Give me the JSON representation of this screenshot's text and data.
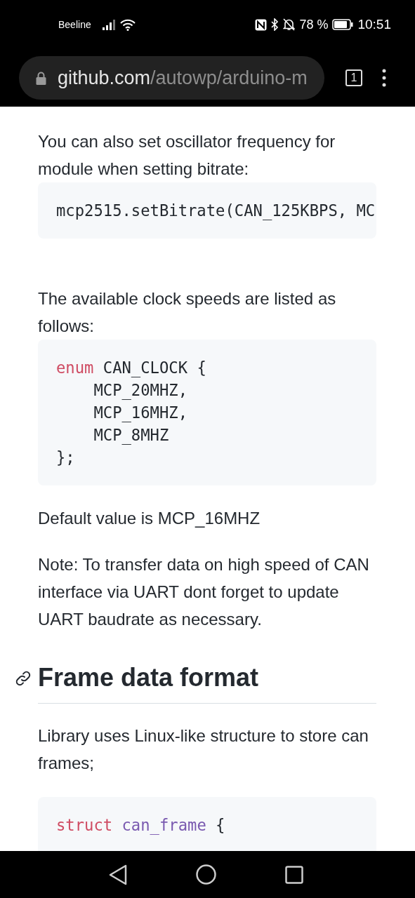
{
  "status_bar": {
    "carrier": "Beeline",
    "battery_percent": "78 %",
    "time": "10:51"
  },
  "address_bar": {
    "host": "github.com",
    "path": "/autowp/arduino-m",
    "tab_count": "1"
  },
  "content": [
    {
      "kind": "paragraph",
      "text": "You can also set oscillator frequency for module when setting bitrate:"
    },
    {
      "kind": "code",
      "lines": [
        [
          {
            "kind": "plain",
            "text": "mcp2515.setBitrate(CAN_125KBPS, MC"
          }
        ]
      ]
    },
    {
      "kind": "paragraph",
      "text": "The available clock speeds are listed as follows:"
    },
    {
      "kind": "code",
      "lines": [
        [
          {
            "kind": "keyword",
            "text": "enum"
          },
          {
            "kind": "plain",
            "text": " CAN_CLOCK {"
          }
        ],
        [
          {
            "kind": "plain",
            "text": "    MCP_20MHZ,"
          }
        ],
        [
          {
            "kind": "plain",
            "text": "    MCP_16MHZ,"
          }
        ],
        [
          {
            "kind": "plain",
            "text": "    MCP_8MHZ"
          }
        ],
        [
          {
            "kind": "plain",
            "text": "};"
          }
        ]
      ]
    },
    {
      "kind": "paragraph",
      "text": "Default value is MCP_16MHZ"
    },
    {
      "kind": "paragraph",
      "text": "Note: To transfer data on high speed of CAN interface via UART dont forget to update UART baudrate as necessary."
    },
    {
      "kind": "heading",
      "text": "Frame data format"
    },
    {
      "kind": "paragraph",
      "text": "Library uses Linux-like structure to store can frames;"
    },
    {
      "kind": "code",
      "lines": [
        [
          {
            "kind": "keyword",
            "text": "struct"
          },
          {
            "kind": "type",
            "text": " can_frame"
          },
          {
            "kind": "plain",
            "text": " {"
          }
        ]
      ]
    }
  ]
}
